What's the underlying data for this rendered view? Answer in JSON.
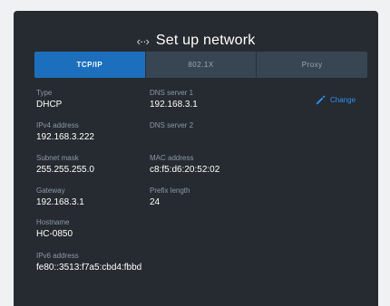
{
  "dialog": {
    "title": "Set up network"
  },
  "tabs": [
    {
      "label": "TCP/IP",
      "active": true
    },
    {
      "label": "802.1X",
      "active": false
    },
    {
      "label": "Proxy",
      "active": false
    }
  ],
  "fields": {
    "type": {
      "label": "Type",
      "value": "DHCP"
    },
    "ipv4": {
      "label": "IPv4 address",
      "value": "192.168.3.222"
    },
    "subnet": {
      "label": "Subnet mask",
      "value": "255.255.255.0"
    },
    "gateway": {
      "label": "Gateway",
      "value": "192.168.3.1"
    },
    "hostname": {
      "label": "Hostname",
      "value": "HC-0850"
    },
    "ipv6": {
      "label": "IPv6 address",
      "value": "fe80::3513:f7a5:cbd4:fbbd"
    },
    "dns1": {
      "label": "DNS server 1",
      "value": "192.168.3.1"
    },
    "dns2": {
      "label": "DNS server 2",
      "value": ""
    },
    "mac": {
      "label": "MAC address",
      "value": "c8:f5:d6:20:52:02"
    },
    "prefix": {
      "label": "Prefix length",
      "value": "24"
    }
  },
  "actions": {
    "change_label": "Change"
  },
  "icons": {
    "title": "network-arrows-icon",
    "change": "pencil-icon"
  },
  "colors": {
    "accent": "#1b6fbd",
    "link": "#2e8ff0",
    "background": "#262b31"
  }
}
